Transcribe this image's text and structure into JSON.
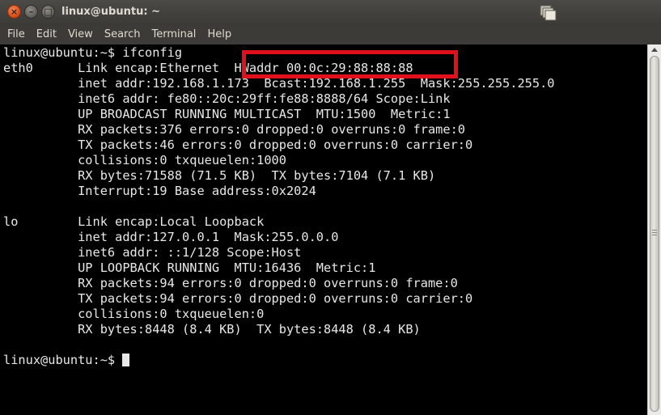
{
  "window": {
    "title": "linux@ubuntu: ~",
    "close_glyph": "×",
    "minimize_glyph": "–",
    "maximize_glyph": "□"
  },
  "menubar": {
    "items": [
      "File",
      "Edit",
      "View",
      "Search",
      "Terminal",
      "Help"
    ]
  },
  "terminal": {
    "lines": [
      "linux@ubuntu:~$ ifconfig",
      "eth0      Link encap:Ethernet  HWaddr 00:0c:29:88:88:88",
      "          inet addr:192.168.1.173  Bcast:192.168.1.255  Mask:255.255.255.0",
      "          inet6 addr: fe80::20c:29ff:fe88:8888/64 Scope:Link",
      "          UP BROADCAST RUNNING MULTICAST  MTU:1500  Metric:1",
      "          RX packets:376 errors:0 dropped:0 overruns:0 frame:0",
      "          TX packets:46 errors:0 dropped:0 overruns:0 carrier:0",
      "          collisions:0 txqueuelen:1000",
      "          RX bytes:71588 (71.5 KB)  TX bytes:7104 (7.1 KB)",
      "          Interrupt:19 Base address:0x2024",
      "",
      "lo        Link encap:Local Loopback",
      "          inet addr:127.0.0.1  Mask:255.0.0.0",
      "          inet6 addr: ::1/128 Scope:Host",
      "          UP LOOPBACK RUNNING  MTU:16436  Metric:1",
      "          RX packets:94 errors:0 dropped:0 overruns:0 frame:0",
      "          TX packets:94 errors:0 dropped:0 overruns:0 carrier:0",
      "          collisions:0 txqueuelen:0",
      "          RX bytes:8448 (8.4 KB)  TX bytes:8448 (8.4 KB)",
      "",
      "linux@ubuntu:~$ "
    ],
    "highlight_color": "#e0101c",
    "text_color": "#e8e8e8",
    "background_color": "#000000"
  },
  "icons": {
    "close": "close-icon",
    "minimize": "minimize-icon",
    "maximize": "maximize-icon",
    "tray": "windows-stack-icon",
    "scroll_up": "scroll-up-arrow-icon"
  }
}
